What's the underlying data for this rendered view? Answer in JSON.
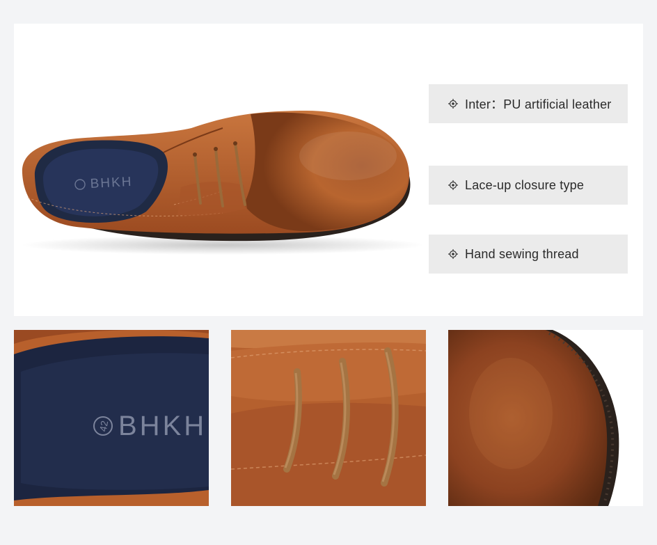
{
  "features": [
    {
      "icon": "crosshair-bullet-icon",
      "label": "Inter：PU artificial leather"
    },
    {
      "icon": "crosshair-bullet-icon",
      "label": "Lace-up closure type"
    },
    {
      "icon": "crosshair-bullet-icon",
      "label": "Hand sewing thread"
    }
  ],
  "brand": {
    "name": "BHKH",
    "size": "42"
  },
  "colors": {
    "background": "#f3f4f6",
    "panel": "#ffffff",
    "feature_box": "#ebebeb",
    "leather": "#b8602c",
    "insole": "#1f2a44",
    "sole": "#2a211c"
  }
}
